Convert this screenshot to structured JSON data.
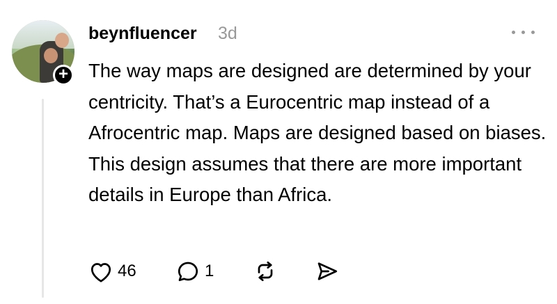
{
  "post": {
    "username": "beynfluencer",
    "time": "3d",
    "text": "The way maps are designed are determined by your centricity. That’s a Eurocentric map instead of a Afrocentric map. Maps are designed based on biases. This design assumes that there are more important details in Europe than Africa.",
    "likes": "46",
    "replies": "1"
  },
  "icons": {
    "avatar": "avatar-photo",
    "follow": "plus-icon",
    "more": "more-options-icon",
    "like": "heart-icon",
    "reply": "comment-icon",
    "repost": "repost-icon",
    "share": "send-icon"
  },
  "colors": {
    "text": "#000000",
    "muted": "#999999",
    "thread_line": "#e6e6e6"
  }
}
